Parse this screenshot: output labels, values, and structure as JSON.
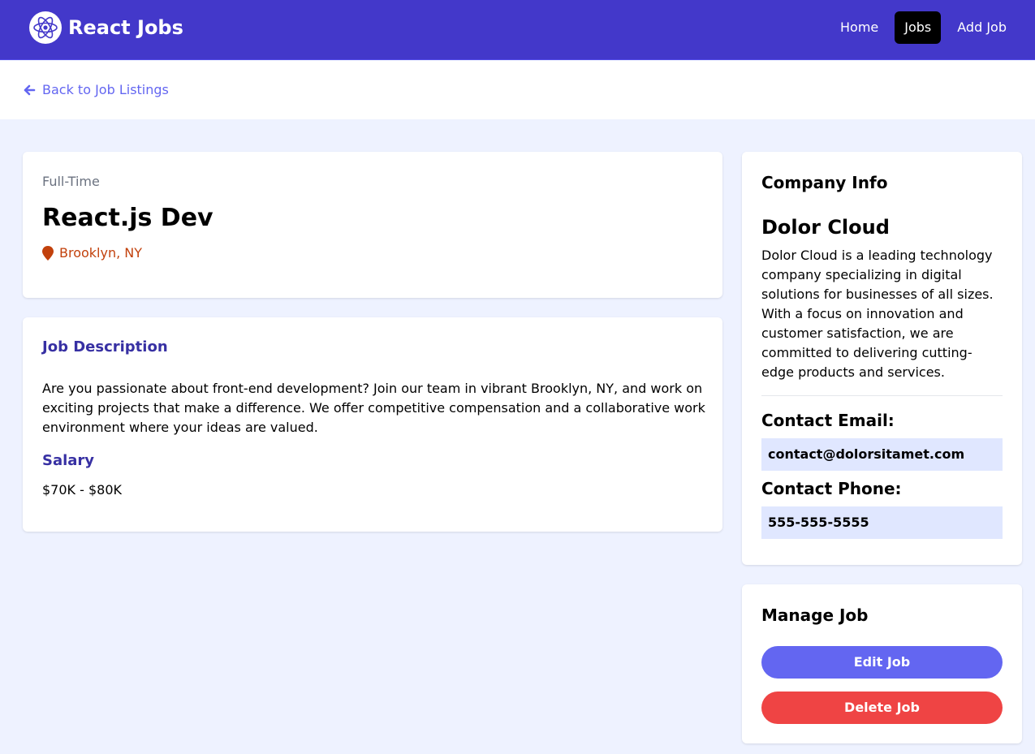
{
  "navbar": {
    "brand": "React Jobs",
    "logo_icon": "react-logo-icon",
    "links": [
      {
        "label": "Home"
      },
      {
        "label": "Jobs",
        "active": true
      },
      {
        "label": "Add Job"
      }
    ],
    "bg_color": "#4338ca"
  },
  "back": {
    "label": "Back to Job Listings",
    "icon": "arrow-left-icon"
  },
  "job": {
    "type": "Full-Time",
    "title": "React.js Dev",
    "location": "Brooklyn, NY",
    "location_icon": "map-marker-icon",
    "description_heading": "Job Description",
    "description": "Are you passionate about front-end development? Join our team in vibrant Brooklyn, NY, and work on exciting projects that make a difference. We offer competitive compensation and a collaborative work environment where your ideas are valued.",
    "salary_heading": "Salary",
    "salary": "$70K - $80K"
  },
  "company": {
    "heading": "Company Info",
    "name": "Dolor Cloud",
    "description": "Dolor Cloud is a leading technology company specializing in digital solutions for businesses of all sizes. With a focus on innovation and customer satisfaction, we are committed to delivering cutting-edge products and services.",
    "email_label": "Contact Email:",
    "email": "contact@dolorsitamet.com",
    "phone_label": "Contact Phone:",
    "phone": "555-555-5555"
  },
  "manage": {
    "heading": "Manage Job",
    "edit_label": "Edit Job",
    "delete_label": "Delete Job"
  },
  "colors": {
    "accent": "#6366f1",
    "danger": "#ef4444",
    "heading": "#3730a3",
    "location": "#c2410c",
    "page_bg": "#eef2ff"
  }
}
